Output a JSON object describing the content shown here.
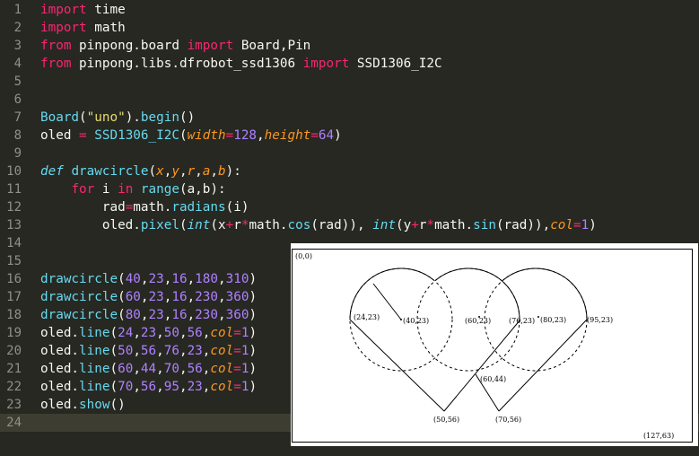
{
  "editor": {
    "lines": [
      {
        "n": "1",
        "tokens": [
          [
            "key",
            "import"
          ],
          [
            "plain",
            " time"
          ]
        ]
      },
      {
        "n": "2",
        "tokens": [
          [
            "key",
            "import"
          ],
          [
            "plain",
            " math"
          ]
        ]
      },
      {
        "n": "3",
        "tokens": [
          [
            "key",
            "from"
          ],
          [
            "plain",
            " pinpong.board "
          ],
          [
            "key",
            "import"
          ],
          [
            "plain",
            " Board,Pin"
          ]
        ]
      },
      {
        "n": "4",
        "tokens": [
          [
            "key",
            "from"
          ],
          [
            "plain",
            " pinpong.libs.dfrobot_ssd1306 "
          ],
          [
            "key",
            "import"
          ],
          [
            "plain",
            " SSD1306_I2C"
          ]
        ]
      },
      {
        "n": "5",
        "tokens": []
      },
      {
        "n": "6",
        "tokens": []
      },
      {
        "n": "7",
        "tokens": [
          [
            "fn",
            "Board"
          ],
          [
            "plain",
            "("
          ],
          [
            "str",
            "\"uno\""
          ],
          [
            "plain",
            ")."
          ],
          [
            "fn",
            "begin"
          ],
          [
            "plain",
            "()"
          ]
        ]
      },
      {
        "n": "8",
        "tokens": [
          [
            "plain",
            "oled "
          ],
          [
            "op",
            "="
          ],
          [
            "plain",
            " "
          ],
          [
            "fn",
            "SSD1306_I2C"
          ],
          [
            "plain",
            "("
          ],
          [
            "param",
            "width"
          ],
          [
            "op",
            "="
          ],
          [
            "num",
            "128"
          ],
          [
            "plain",
            ","
          ],
          [
            "param",
            "height"
          ],
          [
            "op",
            "="
          ],
          [
            "num",
            "64"
          ],
          [
            "plain",
            ")"
          ]
        ]
      },
      {
        "n": "9",
        "tokens": []
      },
      {
        "n": "10",
        "tokens": [
          [
            "def",
            "def"
          ],
          [
            "plain",
            " "
          ],
          [
            "fn",
            "drawcircle"
          ],
          [
            "plain",
            "("
          ],
          [
            "param",
            "x"
          ],
          [
            "plain",
            ","
          ],
          [
            "param",
            "y"
          ],
          [
            "plain",
            ","
          ],
          [
            "param",
            "r"
          ],
          [
            "plain",
            ","
          ],
          [
            "param",
            "a"
          ],
          [
            "plain",
            ","
          ],
          [
            "param",
            "b"
          ],
          [
            "plain",
            "):"
          ]
        ]
      },
      {
        "n": "11",
        "tokens": [
          [
            "plain",
            "    "
          ],
          [
            "key",
            "for"
          ],
          [
            "plain",
            " i "
          ],
          [
            "key",
            "in"
          ],
          [
            "plain",
            " "
          ],
          [
            "fn",
            "range"
          ],
          [
            "plain",
            "(a,b):"
          ]
        ]
      },
      {
        "n": "12",
        "tokens": [
          [
            "plain",
            "        rad"
          ],
          [
            "op",
            "="
          ],
          [
            "plain",
            "math."
          ],
          [
            "fn",
            "radians"
          ],
          [
            "plain",
            "(i)"
          ]
        ]
      },
      {
        "n": "13",
        "tokens": [
          [
            "plain",
            "        oled."
          ],
          [
            "fn",
            "pixel"
          ],
          [
            "plain",
            "("
          ],
          [
            "builtin",
            "int"
          ],
          [
            "plain",
            "(x"
          ],
          [
            "op",
            "+"
          ],
          [
            "plain",
            "r"
          ],
          [
            "op",
            "*"
          ],
          [
            "plain",
            "math."
          ],
          [
            "fn",
            "cos"
          ],
          [
            "plain",
            "(rad)), "
          ],
          [
            "builtin",
            "int"
          ],
          [
            "plain",
            "(y"
          ],
          [
            "op",
            "+"
          ],
          [
            "plain",
            "r"
          ],
          [
            "op",
            "*"
          ],
          [
            "plain",
            "math."
          ],
          [
            "fn",
            "sin"
          ],
          [
            "plain",
            "(rad)),"
          ],
          [
            "param",
            "col"
          ],
          [
            "op",
            "="
          ],
          [
            "num",
            "1"
          ],
          [
            "plain",
            ")"
          ]
        ]
      },
      {
        "n": "14",
        "tokens": []
      },
      {
        "n": "15",
        "tokens": []
      },
      {
        "n": "16",
        "tokens": [
          [
            "fn",
            "drawcircle"
          ],
          [
            "plain",
            "("
          ],
          [
            "num",
            "40"
          ],
          [
            "plain",
            ","
          ],
          [
            "num",
            "23"
          ],
          [
            "plain",
            ","
          ],
          [
            "num",
            "16"
          ],
          [
            "plain",
            ","
          ],
          [
            "num",
            "180"
          ],
          [
            "plain",
            ","
          ],
          [
            "num",
            "310"
          ],
          [
            "plain",
            ")"
          ]
        ]
      },
      {
        "n": "17",
        "tokens": [
          [
            "fn",
            "drawcircle"
          ],
          [
            "plain",
            "("
          ],
          [
            "num",
            "60"
          ],
          [
            "plain",
            ","
          ],
          [
            "num",
            "23"
          ],
          [
            "plain",
            ","
          ],
          [
            "num",
            "16"
          ],
          [
            "plain",
            ","
          ],
          [
            "num",
            "230"
          ],
          [
            "plain",
            ","
          ],
          [
            "num",
            "360"
          ],
          [
            "plain",
            ")"
          ]
        ]
      },
      {
        "n": "18",
        "tokens": [
          [
            "fn",
            "drawcircle"
          ],
          [
            "plain",
            "("
          ],
          [
            "num",
            "80"
          ],
          [
            "plain",
            ","
          ],
          [
            "num",
            "23"
          ],
          [
            "plain",
            ","
          ],
          [
            "num",
            "16"
          ],
          [
            "plain",
            ","
          ],
          [
            "num",
            "230"
          ],
          [
            "plain",
            ","
          ],
          [
            "num",
            "360"
          ],
          [
            "plain",
            ")"
          ]
        ]
      },
      {
        "n": "19",
        "tokens": [
          [
            "plain",
            "oled."
          ],
          [
            "fn",
            "line"
          ],
          [
            "plain",
            "("
          ],
          [
            "num",
            "24"
          ],
          [
            "plain",
            ","
          ],
          [
            "num",
            "23"
          ],
          [
            "plain",
            ","
          ],
          [
            "num",
            "50"
          ],
          [
            "plain",
            ","
          ],
          [
            "num",
            "56"
          ],
          [
            "plain",
            ","
          ],
          [
            "param",
            "col"
          ],
          [
            "op",
            "="
          ],
          [
            "num",
            "1"
          ],
          [
            "plain",
            ")"
          ]
        ]
      },
      {
        "n": "20",
        "tokens": [
          [
            "plain",
            "oled."
          ],
          [
            "fn",
            "line"
          ],
          [
            "plain",
            "("
          ],
          [
            "num",
            "50"
          ],
          [
            "plain",
            ","
          ],
          [
            "num",
            "56"
          ],
          [
            "plain",
            ","
          ],
          [
            "num",
            "76"
          ],
          [
            "plain",
            ","
          ],
          [
            "num",
            "23"
          ],
          [
            "plain",
            ","
          ],
          [
            "param",
            "col"
          ],
          [
            "op",
            "="
          ],
          [
            "num",
            "1"
          ],
          [
            "plain",
            ")"
          ]
        ]
      },
      {
        "n": "21",
        "tokens": [
          [
            "plain",
            "oled."
          ],
          [
            "fn",
            "line"
          ],
          [
            "plain",
            "("
          ],
          [
            "num",
            "60"
          ],
          [
            "plain",
            ","
          ],
          [
            "num",
            "44"
          ],
          [
            "plain",
            ","
          ],
          [
            "num",
            "70"
          ],
          [
            "plain",
            ","
          ],
          [
            "num",
            "56"
          ],
          [
            "plain",
            ","
          ],
          [
            "param",
            "col"
          ],
          [
            "op",
            "="
          ],
          [
            "num",
            "1"
          ],
          [
            "plain",
            ")"
          ]
        ]
      },
      {
        "n": "22",
        "tokens": [
          [
            "plain",
            "oled."
          ],
          [
            "fn",
            "line"
          ],
          [
            "plain",
            "("
          ],
          [
            "num",
            "70"
          ],
          [
            "plain",
            ","
          ],
          [
            "num",
            "56"
          ],
          [
            "plain",
            ","
          ],
          [
            "num",
            "95"
          ],
          [
            "plain",
            ","
          ],
          [
            "num",
            "23"
          ],
          [
            "plain",
            ","
          ],
          [
            "param",
            "col"
          ],
          [
            "op",
            "="
          ],
          [
            "num",
            "1"
          ],
          [
            "plain",
            ")"
          ]
        ]
      },
      {
        "n": "23",
        "tokens": [
          [
            "plain",
            "oled."
          ],
          [
            "fn",
            "show"
          ],
          [
            "plain",
            "()"
          ]
        ]
      },
      {
        "n": "24",
        "tokens": []
      }
    ],
    "current_line": "24"
  },
  "diagram": {
    "labels": {
      "origin": "(0,0)",
      "corner": "(127,63)",
      "p24_23": "(24,23)",
      "c40_23": "(40,23)",
      "c60_23": "(60,23)",
      "p76_23": "(76,23)",
      "c80_23": "(80,23)",
      "p95_23": "(95,23)",
      "p60_44": "(60,44)",
      "p50_56": "(50,56)",
      "p70_56": "(70,56)"
    }
  }
}
